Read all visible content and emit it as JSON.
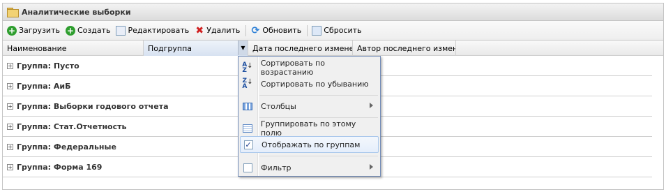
{
  "window": {
    "title": "Аналитические выборки"
  },
  "toolbar": {
    "load": "Загрузить",
    "create": "Создать",
    "edit": "Редактировать",
    "delete": "Удалить",
    "refresh": "Обновить",
    "reset": "Сбросить"
  },
  "columns": [
    "Наименование",
    "Подгруппа",
    "Дата последнего измене...",
    "Автор последнего измен..."
  ],
  "groups": [
    "Группа: Пусто",
    "Группа: АиБ",
    "Группа: Выборки годового отчета",
    "Группа: Стат.Отчетность",
    "Группа: Федеральные",
    "Группа: Форма 169"
  ],
  "menu": {
    "sort_asc": "Сортировать по возрастанию",
    "sort_desc": "Сортировать по убыванию",
    "columns": "Столбцы",
    "group_by": "Группировать по этому полю",
    "show_groups": "Отображать по группам",
    "show_groups_checked": true,
    "filter": "Фильтр",
    "filter_checked": false
  }
}
